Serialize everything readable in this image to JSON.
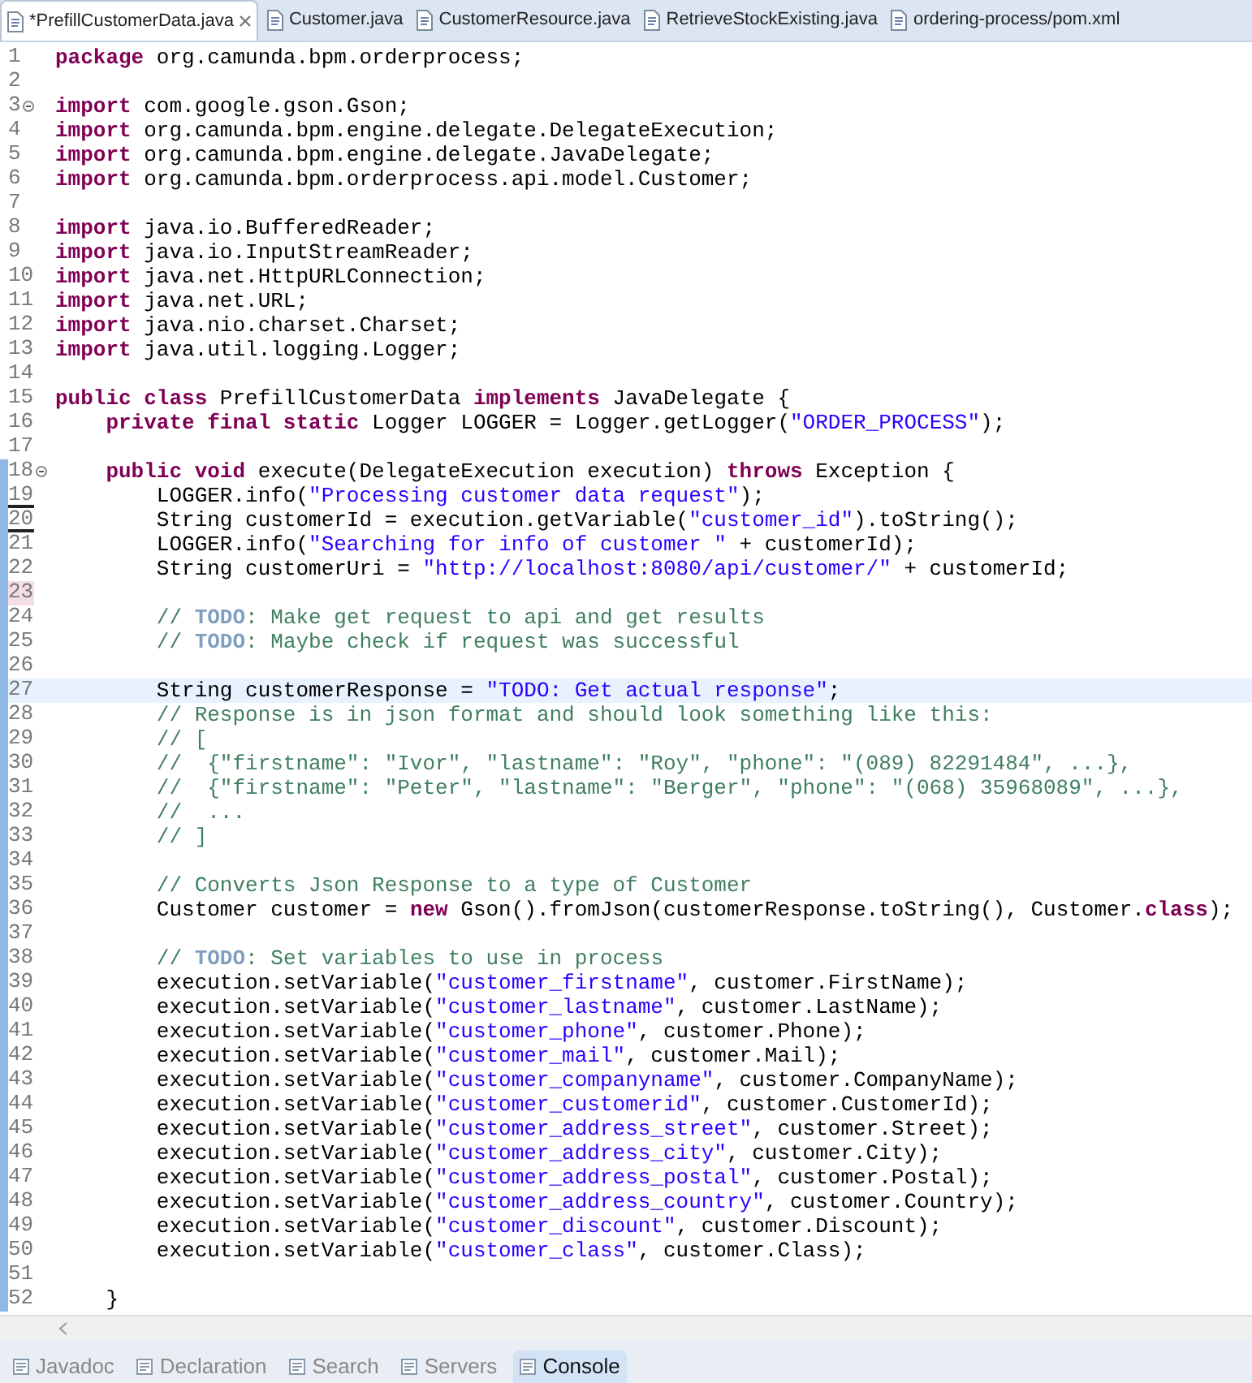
{
  "editor_tabs": [
    {
      "label": "*PrefillCustomerData.java",
      "selected": true,
      "closable": true
    },
    {
      "label": "Customer.java",
      "selected": false,
      "closable": false
    },
    {
      "label": "CustomerResource.java",
      "selected": false,
      "closable": false
    },
    {
      "label": "RetrieveStockExisting.java",
      "selected": false,
      "closable": false
    },
    {
      "label": "ordering-process/pom.xml",
      "selected": false,
      "closable": false
    }
  ],
  "lines": [
    {
      "number": "1",
      "fold": false,
      "current": false,
      "changed": false,
      "deletion_mark": false,
      "highlighted": false,
      "tokens": [
        {
          "kind": "keyword",
          "text": "package "
        },
        {
          "kind": "plain",
          "text": "org.camunda.bpm.orderprocess;"
        }
      ]
    },
    {
      "number": "2",
      "fold": false,
      "current": false,
      "changed": false,
      "deletion_mark": false,
      "highlighted": false
    },
    {
      "number": "3",
      "fold": true,
      "current": false,
      "changed": false,
      "deletion_mark": false,
      "highlighted": false,
      "tokens": [
        {
          "kind": "keyword",
          "text": "import "
        },
        {
          "kind": "plain",
          "text": "com.google.gson.Gson;"
        }
      ]
    },
    {
      "number": "4",
      "fold": false,
      "current": false,
      "changed": false,
      "deletion_mark": false,
      "highlighted": false,
      "tokens": [
        {
          "kind": "keyword",
          "text": "import "
        },
        {
          "kind": "plain",
          "text": "org.camunda.bpm.engine.delegate.DelegateExecution;"
        }
      ]
    },
    {
      "number": "5",
      "fold": false,
      "current": false,
      "changed": false,
      "deletion_mark": false,
      "highlighted": false,
      "tokens": [
        {
          "kind": "keyword",
          "text": "import "
        },
        {
          "kind": "plain",
          "text": "org.camunda.bpm.engine.delegate.JavaDelegate;"
        }
      ]
    },
    {
      "number": "6",
      "fold": false,
      "current": false,
      "changed": false,
      "deletion_mark": false,
      "highlighted": false,
      "tokens": [
        {
          "kind": "keyword",
          "text": "import "
        },
        {
          "kind": "plain",
          "text": "org.camunda.bpm.orderprocess.api.model.Customer;"
        }
      ]
    },
    {
      "number": "7",
      "fold": false,
      "current": false,
      "changed": false,
      "deletion_mark": false,
      "highlighted": false
    },
    {
      "number": "8",
      "fold": false,
      "current": false,
      "changed": false,
      "deletion_mark": false,
      "highlighted": false,
      "tokens": [
        {
          "kind": "keyword",
          "text": "import "
        },
        {
          "kind": "plain",
          "text": "java.io.BufferedReader;"
        }
      ]
    },
    {
      "number": "9",
      "fold": false,
      "current": false,
      "changed": false,
      "deletion_mark": false,
      "highlighted": false,
      "tokens": [
        {
          "kind": "keyword",
          "text": "import "
        },
        {
          "kind": "plain",
          "text": "java.io.InputStreamReader;"
        }
      ]
    },
    {
      "number": "10",
      "fold": false,
      "current": false,
      "changed": false,
      "deletion_mark": false,
      "highlighted": false,
      "tokens": [
        {
          "kind": "keyword",
          "text": "import "
        },
        {
          "kind": "plain",
          "text": "java.net.HttpURLConnection;"
        }
      ]
    },
    {
      "number": "11",
      "fold": false,
      "current": false,
      "changed": false,
      "deletion_mark": false,
      "highlighted": false,
      "tokens": [
        {
          "kind": "keyword",
          "text": "import "
        },
        {
          "kind": "plain",
          "text": "java.net.URL;"
        }
      ]
    },
    {
      "number": "12",
      "fold": false,
      "current": false,
      "changed": false,
      "deletion_mark": false,
      "highlighted": false,
      "tokens": [
        {
          "kind": "keyword",
          "text": "import "
        },
        {
          "kind": "plain",
          "text": "java.nio.charset.Charset;"
        }
      ]
    },
    {
      "number": "13",
      "fold": false,
      "current": false,
      "changed": false,
      "deletion_mark": false,
      "highlighted": false,
      "tokens": [
        {
          "kind": "keyword",
          "text": "import "
        },
        {
          "kind": "plain",
          "text": "java.util.logging.Logger;"
        }
      ]
    },
    {
      "number": "14",
      "fold": false,
      "current": false,
      "changed": false,
      "deletion_mark": false,
      "highlighted": false
    },
    {
      "number": "15",
      "fold": false,
      "current": false,
      "changed": false,
      "deletion_mark": false,
      "highlighted": false,
      "tokens": [
        {
          "kind": "keyword",
          "text": "public class "
        },
        {
          "kind": "plain",
          "text": "PrefillCustomerData "
        },
        {
          "kind": "keyword",
          "text": "implements "
        },
        {
          "kind": "plain",
          "text": "JavaDelegate {"
        }
      ]
    },
    {
      "number": "16",
      "fold": false,
      "current": false,
      "changed": false,
      "deletion_mark": false,
      "highlighted": false,
      "tokens": [
        {
          "kind": "keyword",
          "text": "    private final static "
        },
        {
          "kind": "plain",
          "text": "Logger LOGGER = Logger.getLogger("
        },
        {
          "kind": "string",
          "text": "\"ORDER_PROCESS\""
        },
        {
          "kind": "plain",
          "text": ");"
        }
      ]
    },
    {
      "number": "17",
      "fold": false,
      "current": false,
      "changed": false,
      "deletion_mark": false,
      "highlighted": false
    },
    {
      "number": "18",
      "fold": true,
      "current": false,
      "changed": true,
      "deletion_mark": false,
      "highlighted": false,
      "tokens": [
        {
          "kind": "keyword",
          "text": "    public void "
        },
        {
          "kind": "plain",
          "text": "execute(DelegateExecution execution) "
        },
        {
          "kind": "keyword",
          "text": "throws "
        },
        {
          "kind": "plain",
          "text": "Exception {"
        }
      ]
    },
    {
      "number": "19",
      "fold": false,
      "current": false,
      "changed": true,
      "deletion_mark": true,
      "highlighted": false,
      "tokens": [
        {
          "kind": "plain",
          "text": "        LOGGER.info("
        },
        {
          "kind": "string",
          "text": "\"Processing customer data request\""
        },
        {
          "kind": "plain",
          "text": ");"
        }
      ]
    },
    {
      "number": "20",
      "fold": false,
      "current": false,
      "changed": true,
      "deletion_mark": true,
      "highlighted": false,
      "tokens": [
        {
          "kind": "plain",
          "text": "        String customerId = execution.getVariable("
        },
        {
          "kind": "string",
          "text": "\"customer_id\""
        },
        {
          "kind": "plain",
          "text": ").toString();"
        }
      ]
    },
    {
      "number": "21",
      "fold": false,
      "current": false,
      "changed": true,
      "deletion_mark": false,
      "highlighted": false,
      "tokens": [
        {
          "kind": "plain",
          "text": "        LOGGER.info("
        },
        {
          "kind": "string",
          "text": "\"Searching for info of customer \""
        },
        {
          "kind": "plain",
          "text": " + customerId);"
        }
      ]
    },
    {
      "number": "22",
      "fold": false,
      "current": false,
      "changed": true,
      "deletion_mark": false,
      "highlighted": false,
      "tokens": [
        {
          "kind": "plain",
          "text": "        String customerUri = "
        },
        {
          "kind": "string",
          "text": "\"http://localhost:8080/api/customer/\""
        },
        {
          "kind": "plain",
          "text": " + customerId;"
        }
      ]
    },
    {
      "number": "23",
      "fold": false,
      "current": false,
      "changed": true,
      "deletion_mark": false,
      "highlighted": true
    },
    {
      "number": "24",
      "fold": false,
      "current": false,
      "changed": true,
      "deletion_mark": false,
      "highlighted": false,
      "tokens": [
        {
          "kind": "comment",
          "text": "        // "
        },
        {
          "kind": "todo",
          "text": "TODO"
        },
        {
          "kind": "comment",
          "text": ": Make get request to api and get results"
        }
      ]
    },
    {
      "number": "25",
      "fold": false,
      "current": false,
      "changed": true,
      "deletion_mark": false,
      "highlighted": false,
      "tokens": [
        {
          "kind": "comment",
          "text": "        // "
        },
        {
          "kind": "todo",
          "text": "TODO"
        },
        {
          "kind": "comment",
          "text": ": Maybe check if request was successful"
        }
      ]
    },
    {
      "number": "26",
      "fold": false,
      "current": false,
      "changed": true,
      "deletion_mark": false,
      "highlighted": false
    },
    {
      "number": "27",
      "fold": false,
      "current": true,
      "changed": true,
      "deletion_mark": false,
      "highlighted": false,
      "tokens": [
        {
          "kind": "plain",
          "text": "        String customerResponse = "
        },
        {
          "kind": "string",
          "text": "\"TODO: Get actual response\""
        },
        {
          "kind": "plain",
          "text": ";"
        }
      ]
    },
    {
      "number": "28",
      "fold": false,
      "current": false,
      "changed": true,
      "deletion_mark": false,
      "highlighted": false,
      "tokens": [
        {
          "kind": "comment",
          "text": "        // Response is in json format and should look something like this:"
        }
      ]
    },
    {
      "number": "29",
      "fold": false,
      "current": false,
      "changed": true,
      "deletion_mark": false,
      "highlighted": false,
      "tokens": [
        {
          "kind": "comment",
          "text": "        // ["
        }
      ]
    },
    {
      "number": "30",
      "fold": false,
      "current": false,
      "changed": true,
      "deletion_mark": false,
      "highlighted": false,
      "tokens": [
        {
          "kind": "comment",
          "text": "        //  {\"firstname\": \"Ivor\", \"lastname\": \"Roy\", \"phone\": \"(089) 82291484\", ...},"
        }
      ]
    },
    {
      "number": "31",
      "fold": false,
      "current": false,
      "changed": true,
      "deletion_mark": false,
      "highlighted": false,
      "tokens": [
        {
          "kind": "comment",
          "text": "        //  {\"firstname\": \"Peter\", \"lastname\": \"Berger\", \"phone\": \"(068) 35968089\", ...},"
        }
      ]
    },
    {
      "number": "32",
      "fold": false,
      "current": false,
      "changed": true,
      "deletion_mark": false,
      "highlighted": false,
      "tokens": [
        {
          "kind": "comment",
          "text": "        //  ..."
        }
      ]
    },
    {
      "number": "33",
      "fold": false,
      "current": false,
      "changed": true,
      "deletion_mark": false,
      "highlighted": false,
      "tokens": [
        {
          "kind": "comment",
          "text": "        // ]"
        }
      ]
    },
    {
      "number": "34",
      "fold": false,
      "current": false,
      "changed": true,
      "deletion_mark": false,
      "highlighted": false
    },
    {
      "number": "35",
      "fold": false,
      "current": false,
      "changed": true,
      "deletion_mark": false,
      "highlighted": false,
      "tokens": [
        {
          "kind": "comment",
          "text": "        // Converts Json Response to a type of Customer"
        }
      ]
    },
    {
      "number": "36",
      "fold": false,
      "current": false,
      "changed": true,
      "deletion_mark": false,
      "highlighted": false,
      "tokens": [
        {
          "kind": "plain",
          "text": "        Customer customer = "
        },
        {
          "kind": "keyword",
          "text": "new "
        },
        {
          "kind": "plain",
          "text": "Gson().fromJson(customerResponse.toString(), Customer."
        },
        {
          "kind": "keyword",
          "text": "class"
        },
        {
          "kind": "plain",
          "text": ");"
        }
      ]
    },
    {
      "number": "37",
      "fold": false,
      "current": false,
      "changed": true,
      "deletion_mark": false,
      "highlighted": false
    },
    {
      "number": "38",
      "fold": false,
      "current": false,
      "changed": true,
      "deletion_mark": false,
      "highlighted": false,
      "tokens": [
        {
          "kind": "comment",
          "text": "        // "
        },
        {
          "kind": "todo",
          "text": "TODO"
        },
        {
          "kind": "comment",
          "text": ": Set variables to use in process"
        }
      ]
    },
    {
      "number": "39",
      "fold": false,
      "current": false,
      "changed": true,
      "deletion_mark": false,
      "highlighted": false,
      "tokens": [
        {
          "kind": "plain",
          "text": "        execution.setVariable("
        },
        {
          "kind": "string",
          "text": "\"customer_firstname\""
        },
        {
          "kind": "plain",
          "text": ", customer.FirstName);"
        }
      ]
    },
    {
      "number": "40",
      "fold": false,
      "current": false,
      "changed": true,
      "deletion_mark": false,
      "highlighted": false,
      "tokens": [
        {
          "kind": "plain",
          "text": "        execution.setVariable("
        },
        {
          "kind": "string",
          "text": "\"customer_lastname\""
        },
        {
          "kind": "plain",
          "text": ", customer.LastName);"
        }
      ]
    },
    {
      "number": "41",
      "fold": false,
      "current": false,
      "changed": true,
      "deletion_mark": false,
      "highlighted": false,
      "tokens": [
        {
          "kind": "plain",
          "text": "        execution.setVariable("
        },
        {
          "kind": "string",
          "text": "\"customer_phone\""
        },
        {
          "kind": "plain",
          "text": ", customer.Phone);"
        }
      ]
    },
    {
      "number": "42",
      "fold": false,
      "current": false,
      "changed": true,
      "deletion_mark": false,
      "highlighted": false,
      "tokens": [
        {
          "kind": "plain",
          "text": "        execution.setVariable("
        },
        {
          "kind": "string",
          "text": "\"customer_mail\""
        },
        {
          "kind": "plain",
          "text": ", customer.Mail);"
        }
      ]
    },
    {
      "number": "43",
      "fold": false,
      "current": false,
      "changed": true,
      "deletion_mark": false,
      "highlighted": false,
      "tokens": [
        {
          "kind": "plain",
          "text": "        execution.setVariable("
        },
        {
          "kind": "string",
          "text": "\"customer_companyname\""
        },
        {
          "kind": "plain",
          "text": ", customer.CompanyName);"
        }
      ]
    },
    {
      "number": "44",
      "fold": false,
      "current": false,
      "changed": true,
      "deletion_mark": false,
      "highlighted": false,
      "tokens": [
        {
          "kind": "plain",
          "text": "        execution.setVariable("
        },
        {
          "kind": "string",
          "text": "\"customer_customerid\""
        },
        {
          "kind": "plain",
          "text": ", customer.CustomerId);"
        }
      ]
    },
    {
      "number": "45",
      "fold": false,
      "current": false,
      "changed": true,
      "deletion_mark": false,
      "highlighted": false,
      "tokens": [
        {
          "kind": "plain",
          "text": "        execution.setVariable("
        },
        {
          "kind": "string",
          "text": "\"customer_address_street\""
        },
        {
          "kind": "plain",
          "text": ", customer.Street);"
        }
      ]
    },
    {
      "number": "46",
      "fold": false,
      "current": false,
      "changed": true,
      "deletion_mark": false,
      "highlighted": false,
      "tokens": [
        {
          "kind": "plain",
          "text": "        execution.setVariable("
        },
        {
          "kind": "string",
          "text": "\"customer_address_city\""
        },
        {
          "kind": "plain",
          "text": ", customer.City);"
        }
      ]
    },
    {
      "number": "47",
      "fold": false,
      "current": false,
      "changed": true,
      "deletion_mark": false,
      "highlighted": false,
      "tokens": [
        {
          "kind": "plain",
          "text": "        execution.setVariable("
        },
        {
          "kind": "string",
          "text": "\"customer_address_postal\""
        },
        {
          "kind": "plain",
          "text": ", customer.Postal);"
        }
      ]
    },
    {
      "number": "48",
      "fold": false,
      "current": false,
      "changed": true,
      "deletion_mark": false,
      "highlighted": false,
      "tokens": [
        {
          "kind": "plain",
          "text": "        execution.setVariable("
        },
        {
          "kind": "string",
          "text": "\"customer_address_country\""
        },
        {
          "kind": "plain",
          "text": ", customer.Country);"
        }
      ]
    },
    {
      "number": "49",
      "fold": false,
      "current": false,
      "changed": true,
      "deletion_mark": false,
      "highlighted": false,
      "tokens": [
        {
          "kind": "plain",
          "text": "        execution.setVariable("
        },
        {
          "kind": "string",
          "text": "\"customer_discount\""
        },
        {
          "kind": "plain",
          "text": ", customer.Discount);"
        }
      ]
    },
    {
      "number": "50",
      "fold": false,
      "current": false,
      "changed": true,
      "deletion_mark": false,
      "highlighted": false,
      "tokens": [
        {
          "kind": "plain",
          "text": "        execution.setVariable("
        },
        {
          "kind": "string",
          "text": "\"customer_class\""
        },
        {
          "kind": "plain",
          "text": ", customer.Class);"
        }
      ]
    },
    {
      "number": "51",
      "fold": false,
      "current": false,
      "changed": true,
      "deletion_mark": false,
      "highlighted": false
    },
    {
      "number": "52",
      "fold": false,
      "current": false,
      "changed": true,
      "deletion_mark": false,
      "highlighted": false,
      "tokens": [
        {
          "kind": "plain",
          "text": "    }"
        }
      ]
    }
  ],
  "bottom_tabs": [
    {
      "label": "Javadoc",
      "selected": false
    },
    {
      "label": "Declaration",
      "selected": false
    },
    {
      "label": "Search",
      "selected": false
    },
    {
      "label": "Servers",
      "selected": false
    },
    {
      "label": "Console",
      "selected": true
    }
  ]
}
